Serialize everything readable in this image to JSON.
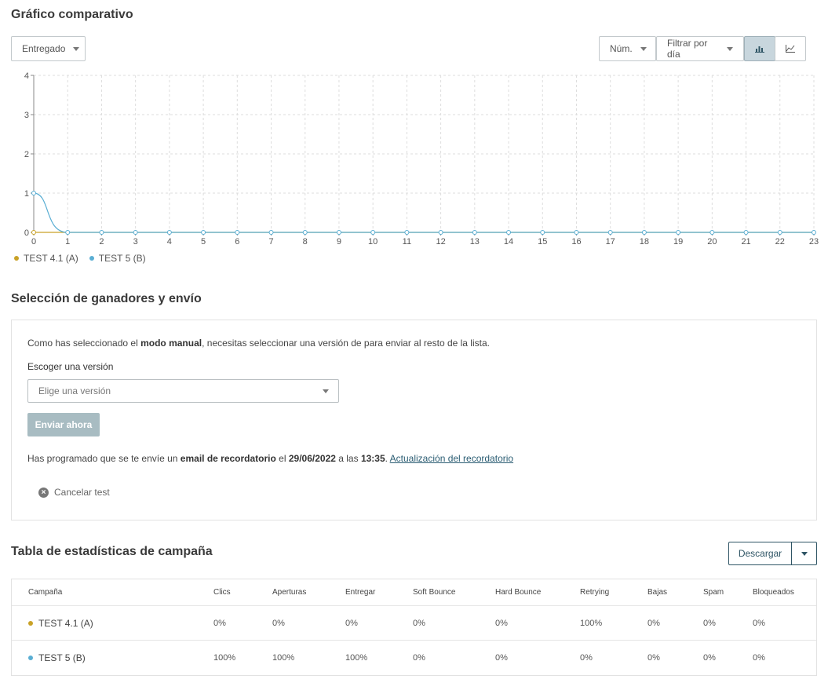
{
  "chart_section": {
    "title": "Gráfico comparativo",
    "metric_dropdown": "Entregado",
    "num_dropdown": "Núm.",
    "filter_dropdown": "Filtrar por día",
    "bar_view_icon": "bar-chart-icon",
    "line_view_icon": "line-chart-icon"
  },
  "chart_data": {
    "type": "line",
    "x": [
      0,
      1,
      2,
      3,
      4,
      5,
      6,
      7,
      8,
      9,
      10,
      11,
      12,
      13,
      14,
      15,
      16,
      17,
      18,
      19,
      20,
      21,
      22,
      23
    ],
    "xlabels": [
      "0",
      "1",
      "2",
      "3",
      "4",
      "5",
      "6",
      "7",
      "8",
      "9",
      "10",
      "11",
      "12",
      "13",
      "14",
      "15",
      "16",
      "17",
      "18",
      "19",
      "20",
      "21",
      "22",
      "23"
    ],
    "yticks": [
      "0",
      "1",
      "2",
      "3",
      "4"
    ],
    "ylim": [
      0,
      4
    ],
    "grid": true,
    "legend_position": "bottom-left",
    "series": [
      {
        "name": "TEST 4.1 (A)",
        "color": "#c9a227",
        "values": [
          0,
          0,
          0,
          0,
          0,
          0,
          0,
          0,
          0,
          0,
          0,
          0,
          0,
          0,
          0,
          0,
          0,
          0,
          0,
          0,
          0,
          0,
          0,
          0
        ]
      },
      {
        "name": "TEST 5 (B)",
        "color": "#5aaed3",
        "values": [
          1,
          0,
          0,
          0,
          0,
          0,
          0,
          0,
          0,
          0,
          0,
          0,
          0,
          0,
          0,
          0,
          0,
          0,
          0,
          0,
          0,
          0,
          0,
          0
        ]
      }
    ]
  },
  "winners_section": {
    "title": "Selección de ganadores y envío",
    "intro_pre": "Como has seleccionado el ",
    "intro_bold": "modo manual",
    "intro_post": ", necesitas seleccionar una versión de para enviar al resto de la lista.",
    "choose_label": "Escoger una versión",
    "select_placeholder": "Elige una versión",
    "send_button": "Enviar ahora",
    "reminder_pre": "Has programado que se te envíe un ",
    "reminder_bold": "email de recordatorio",
    "reminder_mid": " el ",
    "reminder_date": "29/06/2022",
    "reminder_mid2": " a las ",
    "reminder_time": "13:35",
    "reminder_post": ". ",
    "reminder_link": "Actualización del recordatorio",
    "cancel_label": "Cancelar test"
  },
  "stats_section": {
    "title": "Tabla de estadísticas de campaña",
    "download_button": "Descargar",
    "columns": [
      "Campaña",
      "Clics",
      "Aperturas",
      "Entregar",
      "Soft Bounce",
      "Hard Bounce",
      "Retrying",
      "Bajas",
      "Spam",
      "Bloqueados"
    ],
    "rows": [
      {
        "campaign": "TEST 4.1 (A)",
        "color": "#c9a227",
        "values": [
          "0%",
          "0%",
          "0%",
          "0%",
          "0%",
          "100%",
          "0%",
          "0%",
          "0%"
        ]
      },
      {
        "campaign": "TEST 5 (B)",
        "color": "#5aaed3",
        "values": [
          "100%",
          "100%",
          "100%",
          "0%",
          "0%",
          "0%",
          "0%",
          "0%",
          "0%"
        ]
      }
    ]
  }
}
